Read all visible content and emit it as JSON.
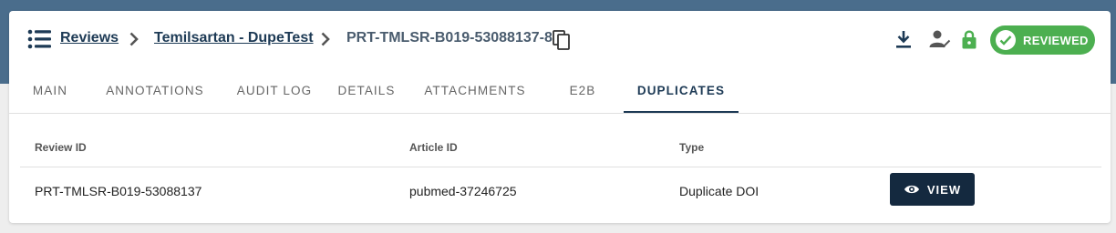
{
  "breadcrumb": {
    "items": [
      "Reviews",
      "Temilsartan - DupeTest"
    ],
    "current": "PRT-TMLSR-B019-53088137-8"
  },
  "status_badge": {
    "label": "REVIEWED",
    "color": "#4caf50"
  },
  "icons": {
    "menu": "menu-icon",
    "copy": "copy-icon",
    "download": "download-icon",
    "user": "user-check-icon",
    "lock": "lock-icon",
    "view": "eye-icon"
  },
  "colors": {
    "header_band": "#4a6d8c",
    "primary": "#1d3a55",
    "button": "#14293f",
    "success": "#4caf50"
  },
  "tabs": [
    {
      "label": "MAIN"
    },
    {
      "label": "ANNOTATIONS"
    },
    {
      "label": "AUDIT LOG"
    },
    {
      "label": "DETAILS"
    },
    {
      "label": "ATTACHMENTS"
    },
    {
      "label": "E2B"
    },
    {
      "label": "DUPLICATES",
      "active": true
    }
  ],
  "table": {
    "headers": [
      "Review ID",
      "Article ID",
      "Type"
    ],
    "rows": [
      {
        "review_id": "PRT-TMLSR-B019-53088137",
        "article_id": "pubmed-37246725",
        "type": "Duplicate DOI",
        "action": "VIEW"
      }
    ]
  }
}
